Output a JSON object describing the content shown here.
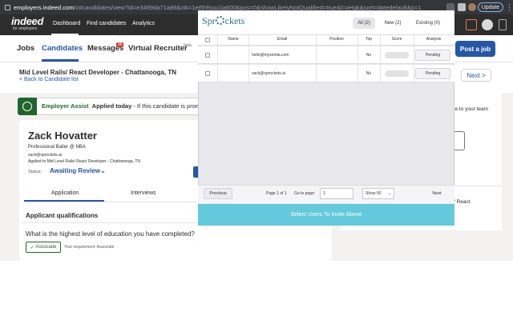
{
  "browser": {
    "url_host": "employers.indeed.com",
    "url_path": "/c#candidates/view?id=e3499da71a89&ctk=1et5hfssu1ia800&pos=0&showLikelyNotQualified=true&l=oHgk&sort=datedefault&p=1",
    "update_label": "Update",
    "menu_glyph": "⋮",
    "lock_icon": "lock-icon"
  },
  "indeed": {
    "logo_text": "indeed",
    "logo_sub": "for employers",
    "nav": [
      "Dashboard",
      "Find candidates",
      "Analytics"
    ],
    "subnav": {
      "jobs": "Jobs",
      "candidates": "Candidates",
      "messages": "Messages",
      "messages_badge": "38",
      "virtual_recruiter": "Virtual Recruiter",
      "beta": "beta",
      "post_job": "Post a job"
    },
    "job_title": "Mid Level Rails/ React Developer - Chattanooga, TN",
    "back_link": "< Back to Candidate list",
    "next": "Next",
    "next_chevron": ">",
    "accent": "#2557a7"
  },
  "assist": {
    "label": "Employer Assist",
    "applied": "Applied today",
    "rest": " - If this candidate is prom"
  },
  "candidate": {
    "name": "Zack Hovatter",
    "headline": "Professional Baller @ NBA",
    "email": "zack@sprockets.ai",
    "applied_to": "Applied to Mid Level Rails/ React Developer - Chattanooga, TN",
    "status_label": "Status:",
    "status_value": "Awaiting Review",
    "status_chevron": "⌄",
    "tabs": [
      "Application",
      "Interviews"
    ],
    "qualifications_title": "Applicant qualifications",
    "question": "What is the highest level of education you have completed?",
    "answer": "Associate",
    "answer_check": "✓",
    "requirement": "Your requirement: Associate"
  },
  "right_panel": {
    "text1": "le to your team",
    "text2": "/ React"
  },
  "sprockets": {
    "logo_a": "Spr",
    "logo_b": "ckets",
    "tabs": [
      {
        "label": "All (2)",
        "active": true
      },
      {
        "label": "New (2)",
        "active": false
      },
      {
        "label": "Existing (0)",
        "active": false
      }
    ],
    "columns": [
      "Name",
      "Email",
      "Position",
      "Top",
      "Score",
      "Analysis"
    ],
    "rows": [
      {
        "name": "",
        "email": "hello@mysentia.com",
        "position": "",
        "top": "No",
        "score": "",
        "analysis": "Pending"
      },
      {
        "name": "",
        "email": "zack@sprockets.ai",
        "position": "",
        "top": "No",
        "score": "",
        "analysis": "Pending"
      }
    ],
    "footer": {
      "previous": "Previous",
      "page_info": "Page 1 of 1",
      "go_to_page": "Go to page:",
      "page_value": "1",
      "show": "Show 50",
      "show_chevron": "⌄",
      "next": "Next"
    },
    "invite_label": "Select Users To Invite Above",
    "invite_color": "#63c9dc"
  }
}
